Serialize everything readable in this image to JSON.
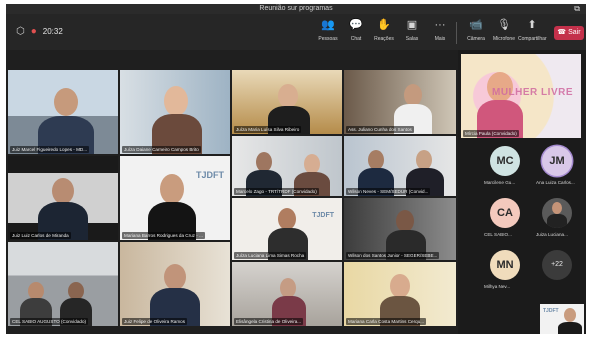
{
  "window": {
    "title": "Reunião sur programas",
    "restore_icon": "restore-icon"
  },
  "toolbar": {
    "timer": "20:32",
    "items": [
      {
        "label": "Pessoas",
        "icon": "people-icon"
      },
      {
        "label": "Chat",
        "icon": "chat-icon"
      },
      {
        "label": "Reações",
        "icon": "raise-hand-icon"
      },
      {
        "label": "Salas",
        "icon": "rooms-icon"
      },
      {
        "label": "Mais",
        "icon": "more-icon"
      },
      {
        "label": "Câmera",
        "icon": "camera-icon"
      },
      {
        "label": "Microfone",
        "icon": "mic-off-icon"
      },
      {
        "label": "Compartilhar",
        "icon": "share-icon"
      }
    ],
    "leave_label": "Sair",
    "leave_color": "#c4314b"
  },
  "grid": {
    "tiles": [
      {
        "name": "Juiz Marcel Figueiredo Lopes - MD..."
      },
      {
        "name": "Juíza Daiane Carneiro Campos Brito"
      },
      {
        "name": "Juíza Maria Luísa Silva Ribeiro"
      },
      {
        "name": "Ass. Juliano Cunha dos Santos"
      },
      {
        "name": "Marcelo Zago - TRT/TRDF (Convidado)"
      },
      {
        "name": "Wilson Neves - SEM/SEDUR (Convid..."
      },
      {
        "name": "Juiz Luiz Carlos de Miranda"
      },
      {
        "name": "Mariana Barros Rodrigues da Cruz - ..."
      },
      {
        "name": "Juíza Luciana Lima Simas Rocha"
      },
      {
        "name": "Wilson dos Santos Junior - SEGER/SEBE..."
      },
      {
        "name": "CEL SABIO AUGUSTO (Convidado)"
      },
      {
        "name": "Juiz Felipe de Oliveira Ramos"
      },
      {
        "name": "Elisângela Cristina de Oliveira..."
      },
      {
        "name": "Mariana Carla Costa Martins Cerqu..."
      }
    ]
  },
  "right_panel": {
    "featured_name": "Mírcia Paula (Convidado)",
    "featured_text": "MULHER LIVRE",
    "participants": [
      {
        "initials": "MC",
        "name": "Marcilene Gu...",
        "color": "#cfe3e2"
      },
      {
        "initials": "JM",
        "name": "Ana Luiza Carlos...",
        "color": "#d9c8e8"
      },
      {
        "initials": "CA",
        "name": "CEL SABIO...",
        "color": "#f3c9bd"
      },
      {
        "initials": "",
        "name": "Juiza Luciana...",
        "color": "#5a5a5a"
      },
      {
        "initials": "MN",
        "name": "Milhya Nev...",
        "color": "#f0dcbc"
      }
    ],
    "more_label": "+22"
  }
}
